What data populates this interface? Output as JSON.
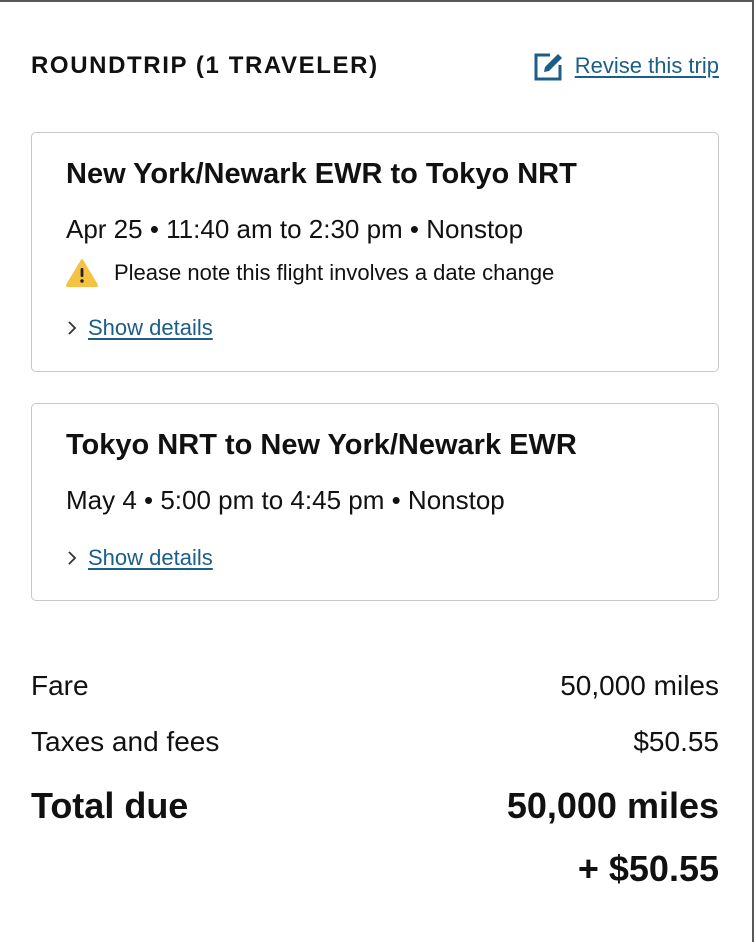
{
  "header": {
    "trip_type": "ROUNDTRIP (1 TRAVELER)",
    "revise_label": "Revise this trip",
    "revise_icon": "edit-icon"
  },
  "flights": [
    {
      "route": "New York/Newark EWR to Tokyo NRT",
      "schedule": "Apr 25 • 11:40 am to 2:30 pm • Nonstop",
      "warning": "Please note this flight involves a date change",
      "warning_icon": "warning-icon",
      "details_label": "Show details"
    },
    {
      "route": "Tokyo NRT to New York/Newark EWR",
      "schedule": "May 4 • 5:00 pm to 4:45 pm • Nonstop",
      "details_label": "Show details"
    }
  ],
  "summary": {
    "fare_label": "Fare",
    "fare_value": "50,000 miles",
    "taxes_label": "Taxes and fees",
    "taxes_value": "$50.55",
    "total_label": "Total due",
    "total_miles": "50,000 miles",
    "total_cash": "+ $50.55"
  },
  "colors": {
    "link": "#1b5e87",
    "warning": "#f5c244",
    "border": "#c8c8c8"
  }
}
